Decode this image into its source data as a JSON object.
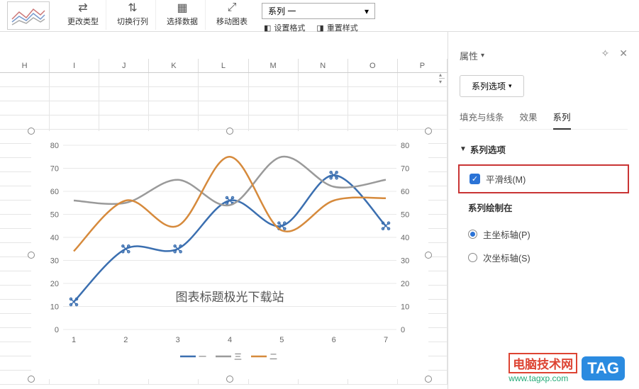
{
  "toolbar": {
    "change_type": "更改类型",
    "switch_rc": "切换行列",
    "select_data": "选择数据",
    "move_chart": "移动图表",
    "set_format": "设置格式",
    "reset_style": "重置样式",
    "series_dropdown": "系列 一"
  },
  "columns": [
    "H",
    "I",
    "J",
    "K",
    "L",
    "M",
    "N",
    "O",
    "P"
  ],
  "panel": {
    "title": "属性",
    "series_options_btn": "系列选项",
    "tabs": {
      "fill": "填充与线条",
      "effect": "效果",
      "series": "系列"
    },
    "section_series_options": "系列选项",
    "smooth_line": "平滑线(M)",
    "section_plot_on": "系列绘制在",
    "primary_axis": "主坐标轴(P)",
    "secondary_axis": "次坐标轴(S)"
  },
  "chart_data": {
    "type": "line",
    "title": "图表标题极光下载站",
    "categories": [
      "1",
      "2",
      "3",
      "4",
      "5",
      "6",
      "7"
    ],
    "y_ticks": [
      0,
      10,
      20,
      30,
      40,
      50,
      60,
      70,
      80
    ],
    "ylim": [
      0,
      80
    ],
    "series": [
      {
        "name": "一",
        "color": "#3b6fb0",
        "values": [
          12,
          35,
          35,
          56,
          45,
          67,
          45
        ]
      },
      {
        "name": "三",
        "color": "#9a9a9a",
        "values": [
          56,
          55,
          65,
          54,
          75,
          62,
          65
        ]
      },
      {
        "name": "二",
        "color": "#d68a3c",
        "values": [
          34,
          56,
          45,
          75,
          43,
          56,
          57
        ]
      }
    ],
    "legend": [
      "一",
      "三",
      "二"
    ]
  },
  "watermark": {
    "title": "电脑技术网",
    "url": "www.tagxp.com",
    "badge": "TAG"
  }
}
